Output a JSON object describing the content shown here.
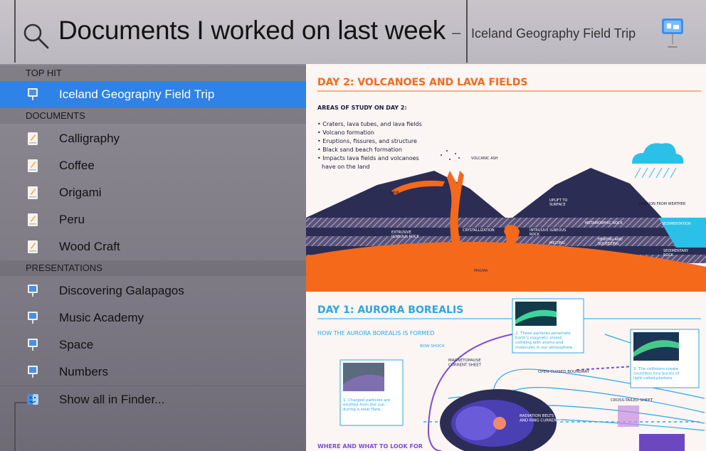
{
  "search": {
    "query": "Documents I worked on last week",
    "separator": "–",
    "top_hit_hint": "Iceland Geography Field Trip"
  },
  "sidebar": {
    "sections": [
      {
        "title": "TOP HIT",
        "items": [
          {
            "label": "Iceland Geography Field Trip",
            "icon": "keynote-icon",
            "selected": true
          }
        ]
      },
      {
        "title": "DOCUMENTS",
        "items": [
          {
            "label": "Calligraphy",
            "icon": "pages-icon"
          },
          {
            "label": "Coffee",
            "icon": "pages-icon"
          },
          {
            "label": "Origami",
            "icon": "pages-icon"
          },
          {
            "label": "Peru",
            "icon": "pages-icon"
          },
          {
            "label": "Wood Craft",
            "icon": "pages-icon"
          }
        ]
      },
      {
        "title": "PRESENTATIONS",
        "items": [
          {
            "label": "Discovering Galapagos",
            "icon": "keynote-icon"
          },
          {
            "label": "Music Academy",
            "icon": "keynote-icon"
          },
          {
            "label": "Space",
            "icon": "keynote-icon"
          },
          {
            "label": "Numbers",
            "icon": "keynote-icon"
          }
        ]
      }
    ],
    "finder": {
      "label": "Show all in Finder...",
      "icon": "finder-icon"
    }
  },
  "preview": {
    "day2": {
      "title": "DAY 2: VOLCANOES AND LAVA FIELDS",
      "subtitle": "AREAS OF STUDY ON DAY 2:",
      "bullets": [
        "• Craters, lava tubes, and lava fields",
        "• Volcano formation",
        "• Eruptions, fissures, and structure",
        "• Black sand beach formation",
        "• Impacts lava fields and volcanoes",
        "   have on the land"
      ],
      "labels": {
        "ash": "VOLCANIC ASH",
        "lava": "LAVA",
        "uplift": "UPLIFT TO\nSURFACE",
        "erosion": "EROSION FROM WEATHER",
        "metamorphic": "METAMORPHIC ROCK",
        "sedimentation": "SEDIMENTATION",
        "extrusive": "EXTRUSIVE\nIGNEOUS ROCK",
        "crystallization": "CRYSTALLIZATION",
        "intrusive": "INTRUSIVE IGNEOUS\nROCK",
        "melting": "MELTING",
        "heating": "HEATING AND\nSQUEEZING",
        "sedimentary": "SEDIMENTARY\nROCK",
        "magma": "MAGMA"
      }
    },
    "day1": {
      "title": "DAY 1: AURORA BOREALIS",
      "subtitle": "HOW THE AURORA BOREALIS IS FORMED",
      "bow_shock": "BOW SHOCK",
      "magnetopause": "MAGNETOPAUSE\nCURRENT SHEET",
      "open_closed": "OPEN-CLOSED BOUNDARY",
      "cross_tailed": "CROSS-TAILED SHEET",
      "radiation": "RADIATION BELTS\nAND RING CURRENTS",
      "cap1": "1. Charged particles are\nemitted from the sun\nduring a solar flare.",
      "cap2": "2. These particles penetrate\nEarth's magnetic shield,\ncolliding with atoms and\nmolecules in our atmosphere.",
      "cap3": "3. The collisions create\ncountless tiny bursts of\nlight called photons.",
      "where": "WHERE AND WHAT TO LOOK FOR"
    }
  },
  "colors": {
    "accent": "#f5691b",
    "selection": "#2f82e6",
    "aurora_blue": "#2aa7e8",
    "navy": "#2c2d54"
  }
}
